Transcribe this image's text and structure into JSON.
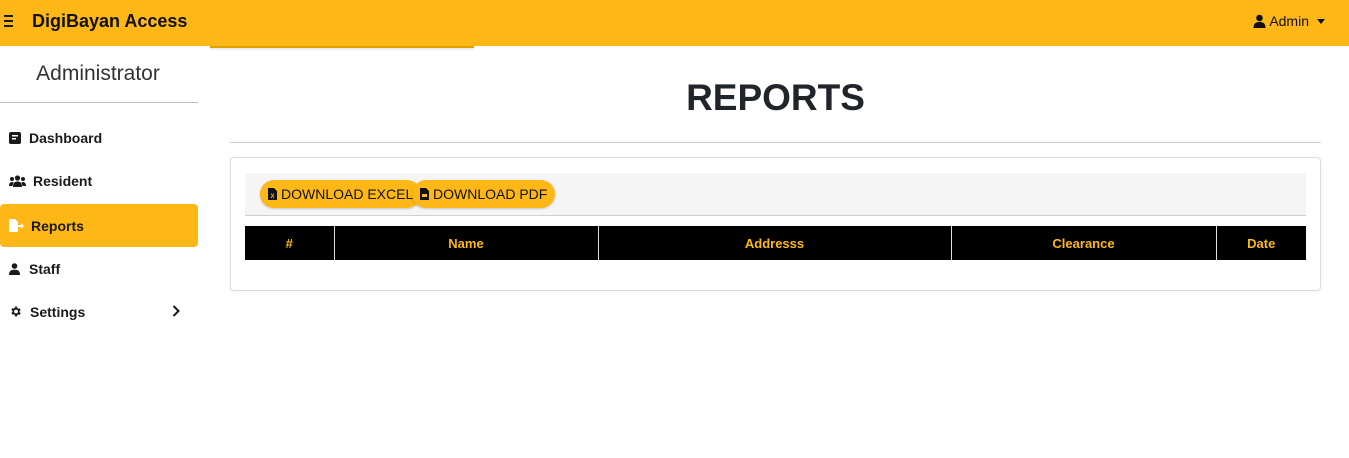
{
  "header": {
    "brand": "DigiBayan Access",
    "user_label": "Admin",
    "menu_icon": "hamburger-icon",
    "user_icon": "user-icon"
  },
  "sidebar": {
    "title": "Administrator",
    "items": [
      {
        "label": "Dashboard",
        "icon": "dashboard-icon",
        "active": false
      },
      {
        "label": "Resident",
        "icon": "users-icon",
        "active": false
      },
      {
        "label": "Reports",
        "icon": "file-export-icon",
        "active": true
      },
      {
        "label": "Staff",
        "icon": "user-icon",
        "active": false
      },
      {
        "label": "Settings",
        "icon": "gear-icon",
        "active": false,
        "has_submenu": true
      }
    ]
  },
  "main": {
    "title": "REPORTS",
    "buttons": {
      "excel": "DOWNLOAD EXCEL",
      "pdf": "DOWNLOAD PDF"
    },
    "table": {
      "columns": [
        "#",
        "Name",
        "Addresss",
        "Clearance",
        "Date"
      ],
      "rows": []
    }
  },
  "colors": {
    "accent": "#FDB817",
    "table_header_bg": "#000000",
    "table_header_text": "#FDB817"
  }
}
